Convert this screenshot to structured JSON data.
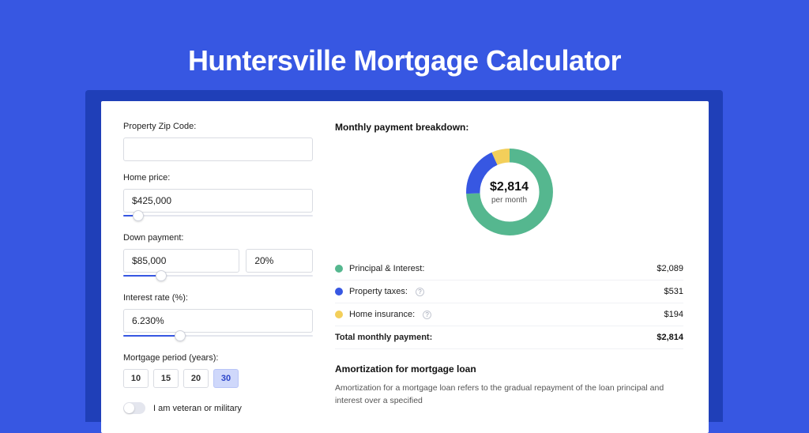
{
  "title": "Huntersville Mortgage Calculator",
  "left": {
    "zip_label": "Property Zip Code:",
    "zip_value": "",
    "price_label": "Home price:",
    "price_value": "$425,000",
    "price_slider_pct": 8,
    "down_label": "Down payment:",
    "down_value": "$85,000",
    "down_pct_value": "20%",
    "down_slider_pct": 20,
    "rate_label": "Interest rate (%):",
    "rate_value": "6.230%",
    "rate_slider_pct": 30,
    "period_label": "Mortgage period (years):",
    "periods": [
      "10",
      "15",
      "20",
      "30"
    ],
    "period_active_index": 3,
    "vet_label": "I am veteran or military"
  },
  "right": {
    "heading": "Monthly payment breakdown:",
    "donut_amount": "$2,814",
    "donut_sub": "per month",
    "legend": [
      {
        "label": "Principal & Interest:",
        "value": "$2,089",
        "color": "#55b78f",
        "hint": false
      },
      {
        "label": "Property taxes:",
        "value": "$531",
        "color": "#3757e2",
        "hint": true
      },
      {
        "label": "Home insurance:",
        "value": "$194",
        "color": "#f3cf5a",
        "hint": true
      }
    ],
    "total_label": "Total monthly payment:",
    "total_value": "$2,814",
    "amort_title": "Amortization for mortgage loan",
    "amort_body": "Amortization for a mortgage loan refers to the gradual repayment of the loan principal and interest over a specified"
  },
  "chart_data": {
    "type": "pie",
    "title": "Monthly payment breakdown",
    "series": [
      {
        "name": "Principal & Interest",
        "value": 2089,
        "color": "#55b78f"
      },
      {
        "name": "Property taxes",
        "value": 531,
        "color": "#3757e2"
      },
      {
        "name": "Home insurance",
        "value": 194,
        "color": "#f3cf5a"
      }
    ],
    "center_label": "$2,814 per month",
    "total": 2814
  }
}
